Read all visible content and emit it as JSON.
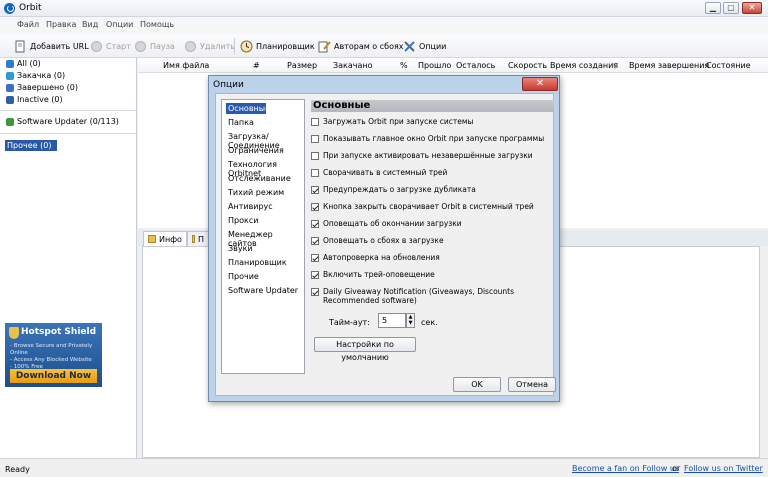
{
  "window": {
    "title": "Orbit"
  },
  "menu": [
    "Файл",
    "Правка",
    "Вид",
    "Опции",
    "Помощь"
  ],
  "toolbar": {
    "add_url": "Добавить URL",
    "start": "Старт",
    "pause": "Пауза",
    "delete": "Удалить",
    "scheduler": "Планировщик",
    "notify_authors": "Авторам о сбоях",
    "options": "Опции"
  },
  "categories": [
    {
      "label": "All (0)",
      "color": "#2e7bd6"
    },
    {
      "label": "Закачка (0)",
      "color": "#2e9ad6"
    },
    {
      "label": "Завершено (0)",
      "color": "#3b6fc4"
    },
    {
      "label": "Inactive (0)",
      "color": "#2d5fa8"
    }
  ],
  "software_updater": "Software Updater (0/113)",
  "other_category": "Прочее (0)",
  "columns": [
    "Имя файла",
    "#",
    "Размер",
    "Закачано",
    "%",
    "Прошло",
    "Осталось",
    "Скорость",
    "Время создания",
    "Время завершения",
    "Состояние"
  ],
  "bottom_tabs": {
    "info": "Инфо",
    "second": "П"
  },
  "ad": {
    "brand": "Hotspot Shield",
    "lines": [
      "- Browse Secure and Privately Online",
      "- Access Any Blocked Website",
      "- 100% Free"
    ],
    "cta": "Download Now"
  },
  "status": {
    "text": "Ready",
    "facebook_link": "Become a fan on Follow us",
    "or": "or",
    "twitter_link": "Follow us on Twitter"
  },
  "dialog": {
    "title": "Опции",
    "nav": [
      "Основные",
      "Папка",
      "Загрузка/Соединение",
      "Ограничения",
      "Технология Orbitnet",
      "Отслеживание",
      "Тихий режим",
      "Антивирус",
      "Прокси",
      "Менеджер сайтов",
      "Звуки",
      "Планировщик",
      "Прочие",
      "Software Updater"
    ],
    "section_title": "Основные",
    "options": [
      {
        "label": "Загружать Orbit при запуске системы",
        "checked": false
      },
      {
        "label": "Показывать главное окно Orbit при запуске программы",
        "checked": false
      },
      {
        "label": "При запуске активировать незавершённые загрузки",
        "checked": false
      },
      {
        "label": "Сворачивать в системный трей",
        "checked": false
      },
      {
        "label": "Предупреждать о загрузке дубликата",
        "checked": true
      },
      {
        "label": "Кнопка закрыть сворачивает Orbit в системный трей",
        "checked": true
      },
      {
        "label": "Оповещать об окончании загрузки",
        "checked": true
      },
      {
        "label": "Оповещать о сбоях в загрузке",
        "checked": true
      },
      {
        "label": "Автопроверка на обновления",
        "checked": true
      },
      {
        "label": "Включить трей-оповещение",
        "checked": true
      },
      {
        "label": "Daily Giveaway Notification (Giveaways, Discounts Recommended software)",
        "checked": true
      }
    ],
    "timeout_label": "Тайм-аут:",
    "timeout_value": "5",
    "timeout_unit": "сек.",
    "defaults_button": "Настройки по умолчанию",
    "ok_button": "OK",
    "cancel_button": "Отмена"
  }
}
